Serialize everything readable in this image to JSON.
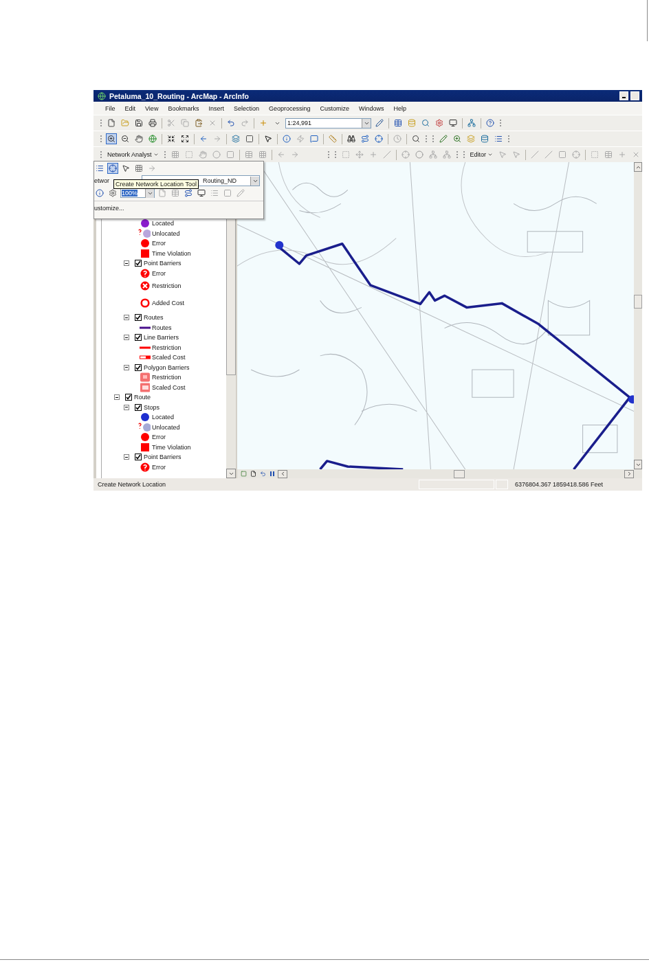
{
  "window": {
    "title": "Petaluma_10_Routing - ArcMap - ArcInfo"
  },
  "menu": [
    "File",
    "Edit",
    "View",
    "Bookmarks",
    "Insert",
    "Selection",
    "Geoprocessing",
    "Customize",
    "Windows",
    "Help"
  ],
  "scale_field": {
    "value": "1:24,991"
  },
  "toolbars": [
    {
      "label": "Network Analyst"
    },
    {
      "label": "Editor"
    }
  ],
  "network_analyst_window": {
    "label": "etwor",
    "network_dropdown": {
      "value": "Routing_ND"
    },
    "zoom_field": {
      "value": "100%"
    },
    "customize": "ustomize...",
    "tooltip": "Create Network Location Tool"
  },
  "legend": [
    {
      "kind": "group",
      "children": [
        {
          "kind": "group",
          "children": [
            {
              "kind": "dot",
              "label": "Located",
              "color": "#8a1ccc"
            },
            {
              "kind": "unlocated",
              "label": "Unlocated",
              "color": "#b9a6dc"
            },
            {
              "kind": "dot",
              "label": "Error",
              "color": "#ff0000"
            },
            {
              "kind": "square",
              "label": "Time Violation",
              "color": "#ff0000"
            }
          ]
        },
        {
          "kind": "group",
          "label": "Point Barriers",
          "checked": true,
          "expanded": true,
          "children": [
            {
              "kind": "error",
              "label": "Error",
              "color": "#ff0000"
            },
            {
              "kind": "restriction",
              "label": "Restriction",
              "color": "#ff0000"
            },
            {
              "kind": "ring",
              "label": "Added Cost",
              "color": "#ff0000"
            }
          ]
        },
        {
          "kind": "group",
          "label": "Routes",
          "checked": true,
          "expanded": true,
          "children": [
            {
              "kind": "line",
              "label": "Routes",
              "color": "#4a108c"
            }
          ]
        },
        {
          "kind": "group",
          "label": "Line Barriers",
          "checked": true,
          "expanded": true,
          "children": [
            {
              "kind": "line",
              "label": "Restriction",
              "color": "#ff0000"
            },
            {
              "kind": "hollowline",
              "label": "Scaled Cost",
              "color": "#ff0000"
            }
          ]
        },
        {
          "kind": "group",
          "label": "Polygon Barriers",
          "checked": true,
          "expanded": true,
          "children": [
            {
              "kind": "polygon",
              "label": "Restriction",
              "color": "#f47070"
            },
            {
              "kind": "hollowpolygon",
              "label": "Scaled Cost",
              "color": "#f47070"
            }
          ]
        }
      ]
    },
    {
      "kind": "group",
      "label": "Route",
      "checked": true,
      "expanded": true,
      "children": [
        {
          "kind": "group",
          "label": "Stops",
          "checked": true,
          "expanded": true,
          "children": [
            {
              "kind": "dot",
              "label": "Located",
              "color": "#1f2fd0"
            },
            {
              "kind": "unlocated",
              "label": "Unlocated",
              "color": "#a6aad6"
            },
            {
              "kind": "dot",
              "label": "Error",
              "color": "#ff0000"
            },
            {
              "kind": "square",
              "label": "Time Violation",
              "color": "#ff0000"
            }
          ]
        },
        {
          "kind": "group",
          "label": "Point Barriers",
          "checked": true,
          "expanded": true,
          "children": [
            {
              "kind": "error",
              "label": "Error",
              "color": "#ff0000"
            }
          ]
        }
      ]
    }
  ],
  "status_bar": {
    "message": "Create Network Location",
    "coordinates": "6376804.367  1859418.586 Feet"
  }
}
